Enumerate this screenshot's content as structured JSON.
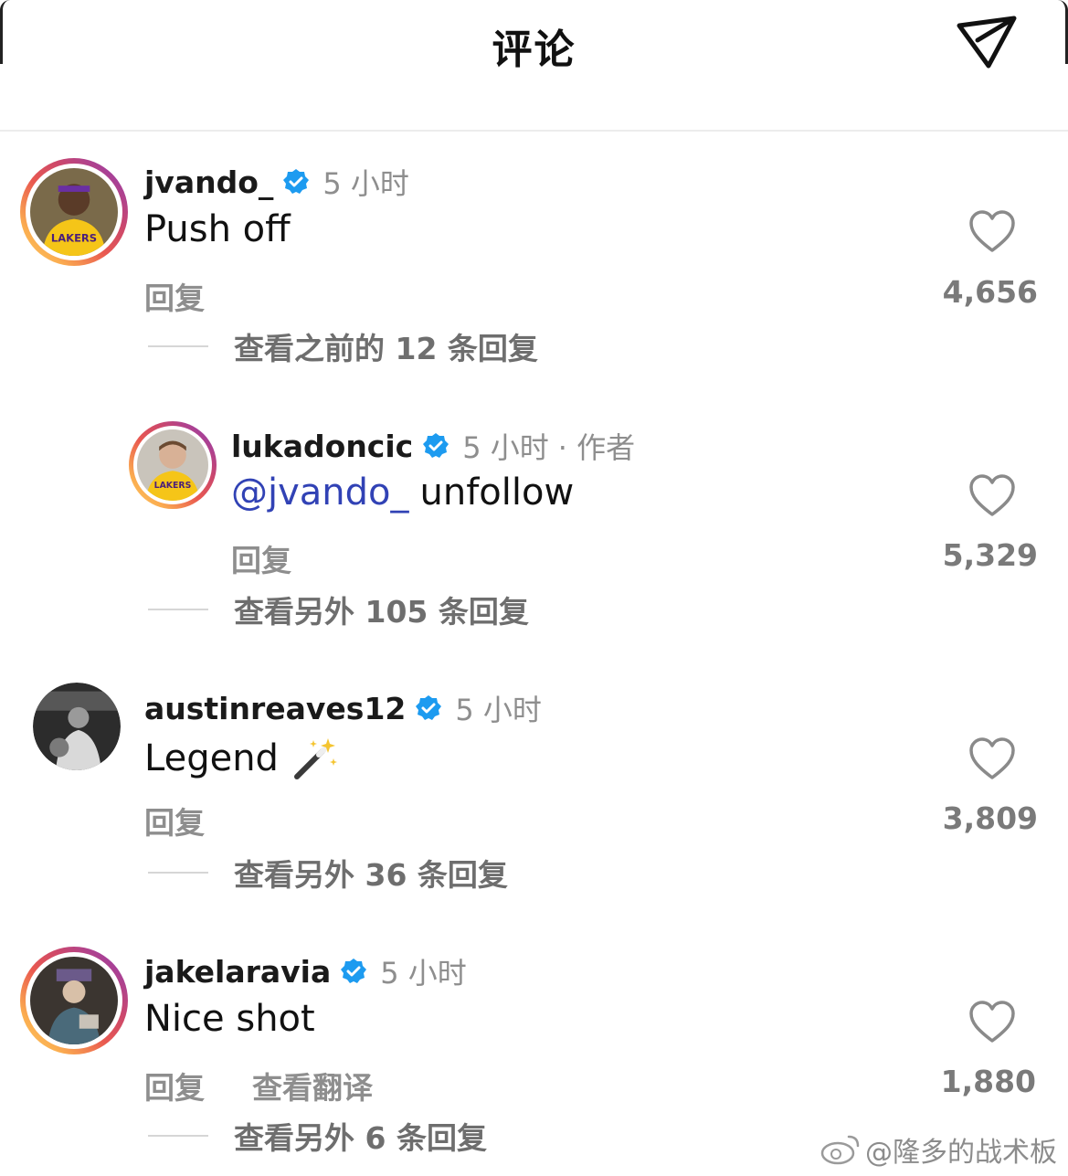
{
  "header": {
    "title": "评论",
    "share_icon": "send-icon"
  },
  "colors": {
    "mention": "#3142b5",
    "verified": "#1d9bf0",
    "muted": "#8e8e8e"
  },
  "comments": [
    {
      "username": "jvando_",
      "verified": true,
      "time": "5 小时",
      "text": "Push off",
      "reply_label": "回复",
      "likes": "4,656",
      "thread": "查看之前的 12 条回复",
      "avatar_icon": "avatar-lakers-player"
    },
    {
      "username": "lukadoncic",
      "verified": true,
      "time": "5 小时",
      "author_label": "· 作者",
      "mention": "@jvando_",
      "text": "unfollow",
      "reply_label": "回复",
      "likes": "5,329",
      "thread": "查看另外 105 条回复",
      "avatar_icon": "avatar-lakers-player"
    },
    {
      "username": "austinreaves12",
      "verified": true,
      "time": "5 小时",
      "text": "Legend",
      "emoji_icon": "magic-wand-icon",
      "reply_label": "回复",
      "likes": "3,809",
      "thread": "查看另外 36 条回复",
      "avatar_icon": "avatar-bw-player"
    },
    {
      "username": "jakelaravia",
      "verified": true,
      "time": "5 小时",
      "text": "Nice shot",
      "reply_label": "回复",
      "translate_label": "查看翻译",
      "likes": "1,880",
      "thread": "查看另外 6 条回复",
      "avatar_icon": "avatar-photo"
    }
  ],
  "watermark": {
    "text": "@隆多的战术板",
    "icon": "weibo-icon"
  }
}
